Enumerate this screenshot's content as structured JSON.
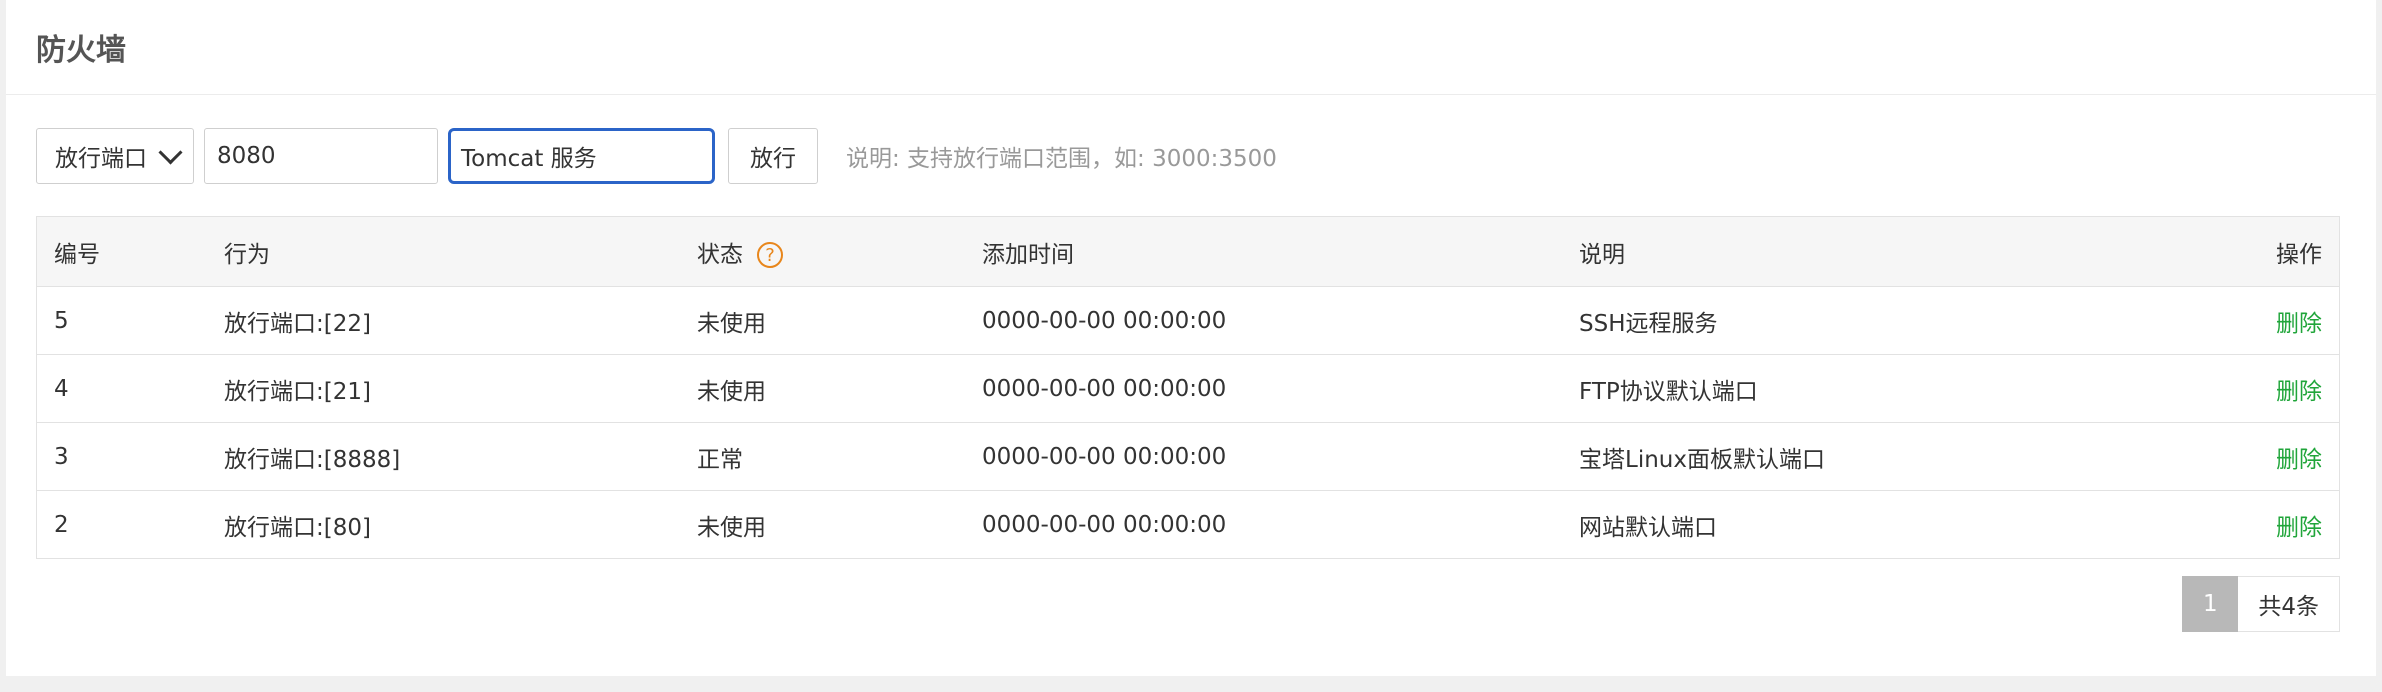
{
  "header": {
    "title": "防火墙"
  },
  "toolbar": {
    "type_select": "放行端口",
    "port_value": "8080",
    "desc_value": "Tomcat 服务",
    "submit_label": "放行",
    "hint": "说明: 支持放行端口范围，如: 3000:3500"
  },
  "table": {
    "columns": [
      "编号",
      "行为",
      "状态",
      "添加时间",
      "说明",
      "操作"
    ],
    "rows": [
      {
        "id": "5",
        "action": "放行端口:[22]",
        "status": "未使用",
        "time": "0000-00-00 00:00:00",
        "desc": "SSH远程服务",
        "op": "删除"
      },
      {
        "id": "4",
        "action": "放行端口:[21]",
        "status": "未使用",
        "time": "0000-00-00 00:00:00",
        "desc": "FTP协议默认端口",
        "op": "删除"
      },
      {
        "id": "3",
        "action": "放行端口:[8888]",
        "status": "正常",
        "time": "0000-00-00 00:00:00",
        "desc": "宝塔Linux面板默认端口",
        "op": "删除"
      },
      {
        "id": "2",
        "action": "放行端口:[80]",
        "status": "未使用",
        "time": "0000-00-00 00:00:00",
        "desc": "网站默认端口",
        "op": "删除"
      }
    ]
  },
  "pager": {
    "current": "1",
    "total": "共4条"
  },
  "colors": {
    "accent_link": "#20a53a",
    "focus_border": "#2b64c8",
    "help_icon": "#e8861b"
  }
}
